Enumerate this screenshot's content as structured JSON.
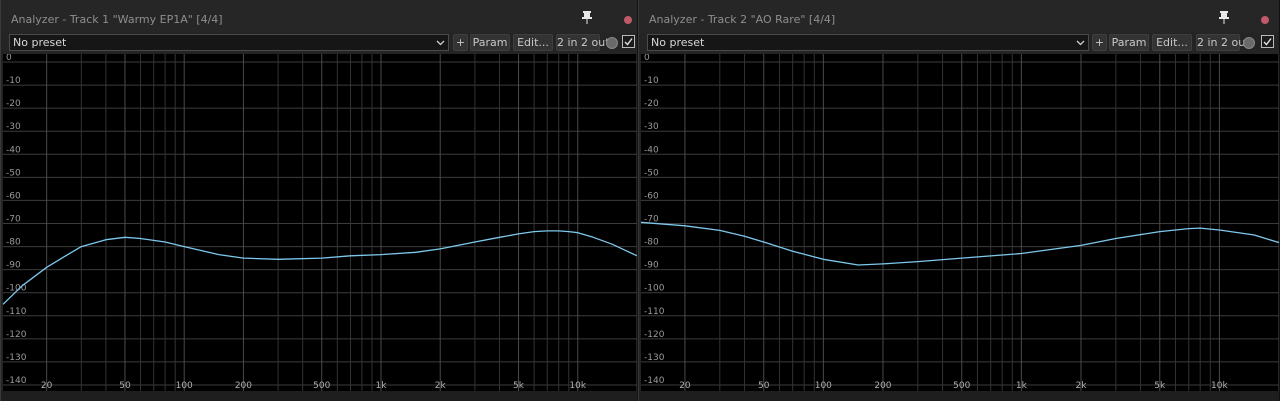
{
  "windows": [
    {
      "title": "Analyzer - Track 1 \"Warmy EP1A\" [4/4]",
      "preset": "No preset",
      "buttons": {
        "add": "+",
        "param": "Param",
        "edit": "Edit...",
        "routing": "2 in 2 out"
      },
      "enabled": true
    },
    {
      "title": "Analyzer - Track 2 \"AO Rare\" [4/4]",
      "preset": "No preset",
      "buttons": {
        "add": "+",
        "param": "Param",
        "edit": "Edit...",
        "routing": "2 in 2 out"
      },
      "enabled": true
    }
  ],
  "colors": {
    "accent_curve": "#7ec8ec",
    "close_dot": "#c05a6a"
  },
  "icons": [
    "pin-icon",
    "close-icon",
    "chevron-down-icon",
    "knob-icon",
    "checkbox-icon"
  ],
  "chart_data": [
    {
      "type": "line",
      "x_scale": "log",
      "xlim": [
        12,
        20000
      ],
      "ylim": [
        -140,
        0
      ],
      "y_ticks": [
        "0",
        "-10",
        "-20",
        "-30",
        "-40",
        "-50",
        "-60",
        "-70",
        "-80",
        "-90",
        "-100",
        "-110",
        "-120",
        "-130",
        "-140"
      ],
      "x_ticks": [
        "20",
        "50",
        "100",
        "200",
        "500",
        "1k",
        "2k",
        "5k",
        "10k"
      ],
      "grid": true,
      "series": [
        {
          "x": [
            12,
            15,
            20,
            25,
            30,
            40,
            50,
            60,
            80,
            100,
            150,
            200,
            300,
            500,
            700,
            1000,
            1500,
            2000,
            3000,
            4000,
            5000,
            6000,
            7000,
            8000,
            9000,
            10000,
            12000,
            15000,
            20000
          ],
          "values": [
            -105,
            -97,
            -89,
            -84,
            -80,
            -77,
            -76,
            -76.5,
            -78,
            -80,
            -83.5,
            -85,
            -85.5,
            -85,
            -84,
            -83.5,
            -82.5,
            -81,
            -78,
            -76,
            -74.5,
            -73.5,
            -73.2,
            -73.2,
            -73.5,
            -74,
            -76,
            -79,
            -84
          ]
        }
      ]
    },
    {
      "type": "line",
      "x_scale": "log",
      "xlim": [
        12,
        20000
      ],
      "ylim": [
        -140,
        0
      ],
      "y_ticks": [
        "0",
        "-10",
        "-20",
        "-30",
        "-40",
        "-50",
        "-60",
        "-70",
        "-80",
        "-90",
        "-100",
        "-110",
        "-120",
        "-130",
        "-140"
      ],
      "x_ticks": [
        "20",
        "50",
        "100",
        "200",
        "500",
        "1k",
        "2k",
        "5k",
        "10k"
      ],
      "grid": true,
      "series": [
        {
          "x": [
            12,
            20,
            30,
            40,
            50,
            70,
            100,
            150,
            200,
            300,
            500,
            1000,
            2000,
            3000,
            5000,
            7000,
            8000,
            10000,
            15000,
            20000
          ],
          "values": [
            -69.5,
            -71,
            -73,
            -75.5,
            -78,
            -82,
            -85.5,
            -88,
            -87.5,
            -86.5,
            -85,
            -83,
            -79.5,
            -76.5,
            -73.5,
            -72.2,
            -72,
            -72.8,
            -75,
            -78.3
          ]
        }
      ]
    }
  ]
}
